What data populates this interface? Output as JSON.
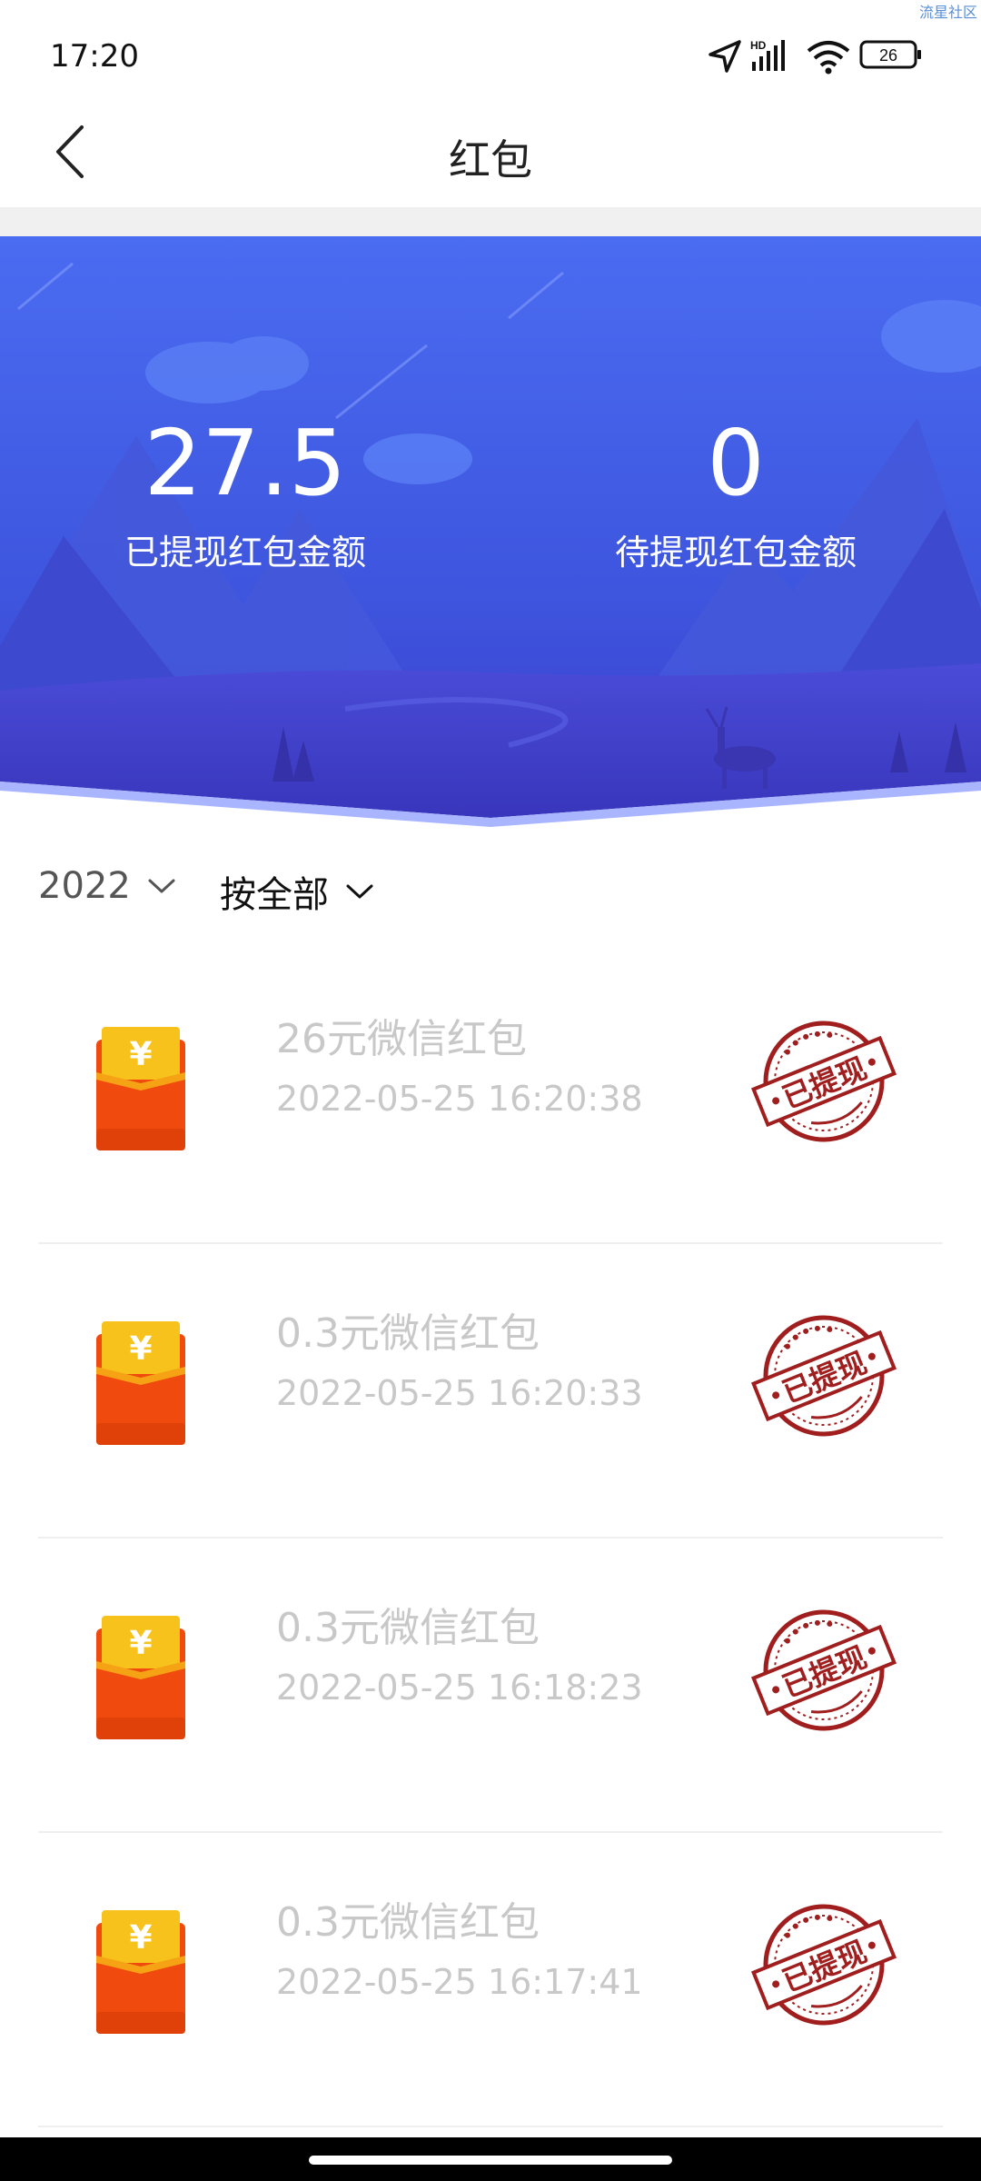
{
  "status_bar": {
    "time": "17:20",
    "watermark": "流星社区",
    "network": "HD",
    "battery": "26",
    "icons": [
      "location-icon",
      "signal-icon",
      "wifi-icon",
      "battery-icon"
    ]
  },
  "header": {
    "title": "红包",
    "back_icon": "chevron-left-icon"
  },
  "banner": {
    "withdrawn_amount": "27.5",
    "withdrawn_label": "已提现红包金额",
    "pending_amount": "0",
    "pending_label": "待提现红包金额"
  },
  "filters": {
    "year": "2022",
    "type": "按全部"
  },
  "records": [
    {
      "title": "26元微信红包",
      "time": "2022-05-25 16:20:38",
      "stamp": "已提现"
    },
    {
      "title": "0.3元微信红包",
      "time": "2022-05-25 16:20:33",
      "stamp": "已提现"
    },
    {
      "title": "0.3元微信红包",
      "time": "2022-05-25 16:18:23",
      "stamp": "已提现"
    },
    {
      "title": "0.3元微信红包",
      "time": "2022-05-25 16:17:41",
      "stamp": "已提现"
    }
  ],
  "colors": {
    "banner_top": "#4a6af0",
    "banner_bottom": "#3a3fd2",
    "envelope": "#f04a0e",
    "envelope_flap": "#f7c21b",
    "stamp": "#a01e1e"
  }
}
